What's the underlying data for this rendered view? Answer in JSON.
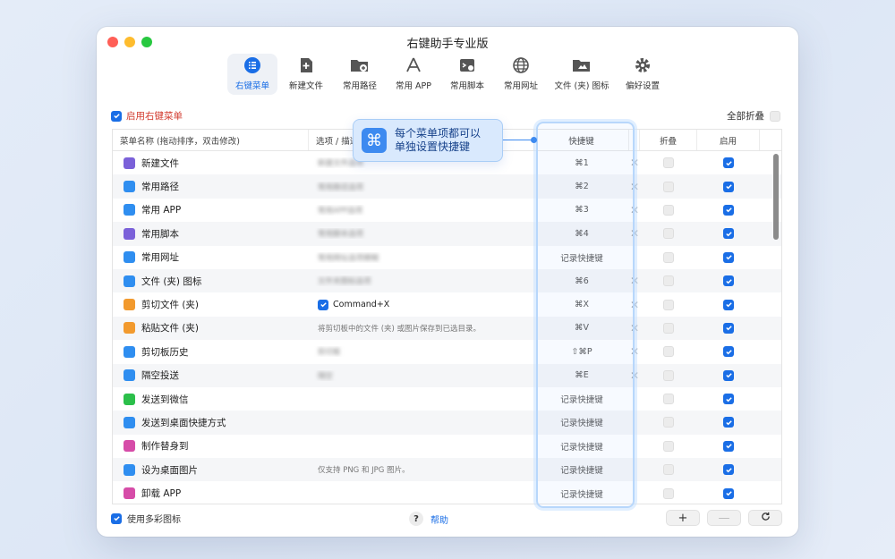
{
  "window": {
    "title": "右键助手专业版"
  },
  "toolbar": {
    "tabs": [
      {
        "label": "右键菜单",
        "icon": "list-icon",
        "active": true
      },
      {
        "label": "新建文件",
        "icon": "new-file-icon",
        "active": false
      },
      {
        "label": "常用路径",
        "icon": "folder-path-icon",
        "active": false
      },
      {
        "label": "常用 APP",
        "icon": "app-store-icon",
        "active": false
      },
      {
        "label": "常用脚本",
        "icon": "script-icon",
        "active": false
      },
      {
        "label": "常用网址",
        "icon": "globe-icon",
        "active": false
      },
      {
        "label": "文件 (夹) 图标",
        "icon": "folder-image-icon",
        "active": false
      },
      {
        "label": "偏好设置",
        "icon": "gear-icon",
        "active": false
      }
    ]
  },
  "controls": {
    "enable_label": "启用右键菜单",
    "enable_checked": true,
    "collapse_all_label": "全部折叠",
    "collapse_all_checked": false
  },
  "table": {
    "headers": {
      "name": "菜单名称 (拖动排序，双击修改)",
      "options": "选项 / 描述",
      "shortcut": "快捷键",
      "fold": "折叠",
      "enabled": "启用"
    },
    "rows": [
      {
        "name": "新建文件",
        "icon_color": "#7b61d9",
        "icon": "new-file-icon",
        "options": "新建文件选项",
        "options_blurred": true,
        "shortcut": "⌘1",
        "has_x": true,
        "enabled": true
      },
      {
        "name": "常用路径",
        "icon_color": "#2f8ef0",
        "icon": "folder-path-icon",
        "options": "常用路径选项",
        "options_blurred": true,
        "shortcut": "⌘2",
        "has_x": true,
        "enabled": true
      },
      {
        "name": "常用 APP",
        "icon_color": "#2f8ef0",
        "icon": "app-store-icon",
        "options": "常用APP选项",
        "options_blurred": true,
        "shortcut": "⌘3",
        "has_x": true,
        "enabled": true
      },
      {
        "name": "常用脚本",
        "icon_color": "#7b61d9",
        "icon": "script-icon",
        "options": "常用脚本选项",
        "options_blurred": true,
        "shortcut": "⌘4",
        "has_x": true,
        "enabled": true
      },
      {
        "name": "常用网址",
        "icon_color": "#2f8ef0",
        "icon": "globe-icon",
        "options": "常用网址选项模糊",
        "options_blurred": true,
        "shortcut": "记录快捷键",
        "has_x": false,
        "enabled": true
      },
      {
        "name": "文件 (夹) 图标",
        "icon_color": "#2f8ef0",
        "icon": "folder-image-icon",
        "options": "文件夹图标选项",
        "options_blurred": true,
        "shortcut": "⌘6",
        "has_x": true,
        "enabled": true
      },
      {
        "name": "剪切文件 (夹)",
        "icon_color": "#f29a2e",
        "icon": "scissors-icon",
        "options": "Command+X",
        "options_checkbox": true,
        "options_blurred": false,
        "shortcut": "⌘X",
        "has_x": true,
        "enabled": true
      },
      {
        "name": "粘贴文件 (夹)",
        "icon_color": "#f29a2e",
        "icon": "paste-icon",
        "options": "将剪切板中的文件 (夹) 或图片保存到已选目录。",
        "options_blurred": false,
        "shortcut": "⌘V",
        "has_x": true,
        "enabled": true
      },
      {
        "name": "剪切板历史",
        "icon_color": "#2f8ef0",
        "icon": "clipboard-icon",
        "options": "剪切板",
        "options_blurred": true,
        "shortcut": "⇧⌘P",
        "has_x": true,
        "enabled": true
      },
      {
        "name": "隔空投送",
        "icon_color": "#2f8ef0",
        "icon": "airdrop-icon",
        "options": "隔空",
        "options_blurred": true,
        "shortcut": "⌘E",
        "has_x": true,
        "enabled": true
      },
      {
        "name": "发送到微信",
        "icon_color": "#2bbf4a",
        "icon": "wechat-icon",
        "options": "",
        "options_blurred": false,
        "shortcut": "记录快捷键",
        "has_x": false,
        "enabled": true
      },
      {
        "name": "发送到桌面快捷方式",
        "icon_color": "#2f8ef0",
        "icon": "shortcut-icon",
        "options": "",
        "options_blurred": false,
        "shortcut": "记录快捷键",
        "has_x": false,
        "enabled": true
      },
      {
        "name": "制作替身到",
        "icon_color": "#d64ca8",
        "icon": "alias-icon",
        "options": "",
        "options_blurred": false,
        "shortcut": "记录快捷键",
        "has_x": false,
        "enabled": true
      },
      {
        "name": "设为桌面图片",
        "icon_color": "#2f8ef0",
        "icon": "desktop-icon",
        "options": "仅支持 PNG 和 JPG 图片。",
        "options_blurred": false,
        "shortcut": "记录快捷键",
        "has_x": false,
        "enabled": true
      },
      {
        "name": "卸载 APP",
        "icon_color": "#d64ca8",
        "icon": "uninstall-icon",
        "options": "",
        "options_blurred": false,
        "shortcut": "记录快捷键",
        "has_x": false,
        "enabled": true
      }
    ]
  },
  "callout": {
    "line1": "每个菜单项都可以",
    "line2": "单独设置快捷键",
    "icon": "command-icon"
  },
  "footer": {
    "multicolor_label": "使用多彩图标",
    "multicolor_checked": true,
    "help_label": "帮助",
    "help_icon": "question-icon",
    "add_label": "+",
    "remove_label": "—",
    "refresh_icon": "refresh-icon"
  },
  "colors": {
    "accent": "#1a6ee6",
    "enable_text": "#d23a2e",
    "callout_bg": "#d9e9fd"
  }
}
